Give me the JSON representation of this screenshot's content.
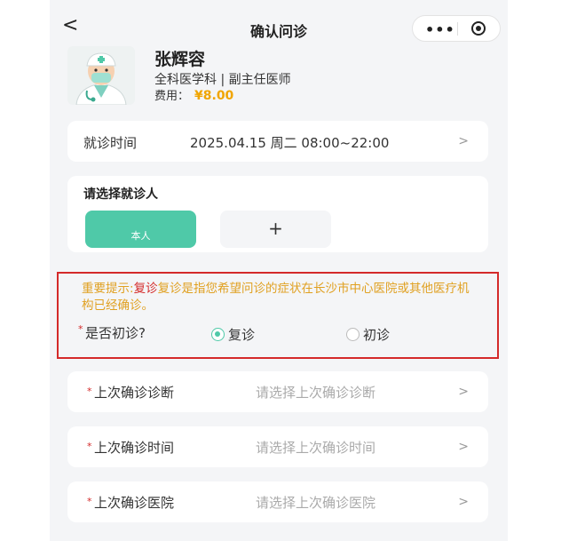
{
  "nav": {
    "back_icon": "chevron-left-icon",
    "title": "确认问诊",
    "more_icon": "more-dots-icon",
    "close_icon": "miniprogram-close-icon"
  },
  "doctor": {
    "name": "张辉容",
    "title": "全科医学科 | 副主任医师",
    "fee_label": "费用：",
    "fee_value": "¥8.00"
  },
  "visit_time": {
    "label": "就诊时间",
    "value": "2025.04.15 周二 08:00~22:00"
  },
  "patient": {
    "heading": "请选择就诊人",
    "self_label": "本人",
    "add_label": "+"
  },
  "notice": {
    "prefix": "重要提示:",
    "highlight": "复诊",
    "rest": "复诊是指您希望问诊的症状在长沙市中心医院或其他医疗机构已经确诊。",
    "question": "是否初诊?",
    "options": [
      {
        "label": "复诊",
        "checked": true
      },
      {
        "label": "初诊",
        "checked": false
      }
    ]
  },
  "rows": [
    {
      "label": "上次确诊诊断",
      "placeholder": "请选择上次确诊诊断"
    },
    {
      "label": "上次确诊时间",
      "placeholder": "请选择上次确诊时间"
    },
    {
      "label": "上次确诊医院",
      "placeholder": "请选择上次确诊医院"
    }
  ],
  "required_mark": "*",
  "chevron": ">",
  "colors": {
    "accent": "#4fc9a8",
    "warning": "#e0a020",
    "alert": "#d42a2a",
    "fee": "#f0a500"
  }
}
